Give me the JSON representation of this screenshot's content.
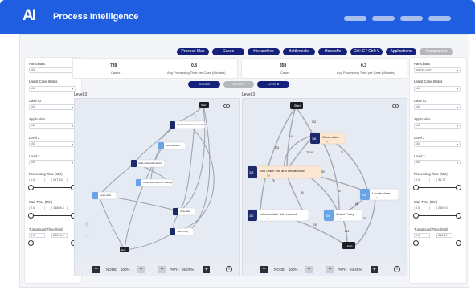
{
  "header": {
    "title": "Process Intelligence",
    "logo_text": "AI",
    "accent": "#1f5ee0"
  },
  "nav": {
    "tabs": [
      "Process Map",
      "Cases",
      "Hierarchies",
      "Bottlenecks",
      "Handoffs",
      "Ctrl+C / Ctrl+V",
      "Applications",
      "Comparison"
    ]
  },
  "left_filters": {
    "participant_label": "Participant",
    "participant_value": "All",
    "latest_case_status_label": "Latest Case Status",
    "latest_case_status_value": "All",
    "case_id_label": "Case ID",
    "case_id_value": "All",
    "application_label": "Application",
    "application_value": "All",
    "level2_label": "Level 2",
    "level2_value": "All",
    "level3_label": "Level 3",
    "level3_value": "All",
    "processing_time_label": "Processing Time (Min)",
    "processing_time_min": "0.0",
    "processing_time_max": "217.33",
    "wait_time_label": "Wait Time (Min)",
    "wait_time_min": "0.0",
    "wait_time_max": "14808.3",
    "turnaround_time_label": "Turnaround Time (Min)",
    "turnaround_time_min": "0.0",
    "turnaround_time_max": "24813.6"
  },
  "right_filters": {
    "participant_label": "Participant",
    "participant_value": "admin.user",
    "latest_case_status_label": "Latest Case Status",
    "latest_case_status_value": "All",
    "case_id_label": "Case ID",
    "case_id_value": "All",
    "application_label": "Application",
    "application_value": "All",
    "level2_label": "Level 2",
    "level2_value": "All",
    "level3_label": "Level 3",
    "level3_value": "All",
    "processing_time_label": "Processing Time (Min)",
    "processing_time_min": "0.0",
    "processing_time_max": "36.77",
    "wait_time_label": "Wait Time (Min)",
    "wait_time_min": "0.0",
    "wait_time_max": "2400.3",
    "turnaround_time_label": "Turnaround Time (Min)",
    "turnaround_time_min": "0.0",
    "turnaround_time_max": "368.67"
  },
  "stats_left": {
    "cases_value": "739",
    "cases_label": "Cases",
    "apt_value": "0.8",
    "apt_label": "Avg Processing Time per Case (Minutes)"
  },
  "stats_right": {
    "cases_value": "350",
    "cases_label": "Cases",
    "apt_value": "0.3",
    "apt_label": "Avg Processing Time per Case (Minutes)"
  },
  "level_tabs": {
    "events": "Events",
    "level3": "Level 3",
    "level2": "Level 2"
  },
  "left_panel": {
    "title": "Level 3",
    "node_label": "NODE:",
    "node_value": "100%",
    "path_label": "PATH:",
    "path_value": "85.00%",
    "nodes": {
      "start": "Start",
      "add_claim": "Add Claim info and create claim",
      "close_exposure": "Close Exposure",
      "initial_contact": "Initial contact with insured",
      "review_and_inspect": "Review and inspect for coverage",
      "locate_claim": "Locate claim",
      "close_claim": "Close claim",
      "select_policy": "Select Policy",
      "end": "End"
    }
  },
  "right_panel": {
    "title": "Level 3",
    "node_label": "NODE:",
    "node_value": "100%",
    "path_label": "PATH:",
    "path_value": "84.48%",
    "nodes": {
      "start": "Start",
      "close_claim": "Close claim",
      "close_claim_count": "308",
      "close_claim_time": "4s",
      "add_claim": "Add Claim info and create claim",
      "add_claim_count": "308",
      "add_claim_time": "15s",
      "locate_claim": "Locate claim",
      "locate_claim_count": "304",
      "locate_claim_time": "1s",
      "initial_contact": "Initial contact with insured",
      "initial_contact_count": "305",
      "initial_contact_time": "2s",
      "select_policy": "Select Policy",
      "select_policy_count": "304",
      "select_policy_time": "1s",
      "end": "End"
    },
    "edges": {
      "e1": "101",
      "e2": "143",
      "e3": "75",
      "e4": "72",
      "e5": "75 16",
      "e6": "31",
      "e7": "80",
      "e8": "80",
      "e9": "80",
      "e10": "68",
      "e11": "151",
      "e12": "224",
      "e13": "30",
      "e14": "101"
    }
  }
}
